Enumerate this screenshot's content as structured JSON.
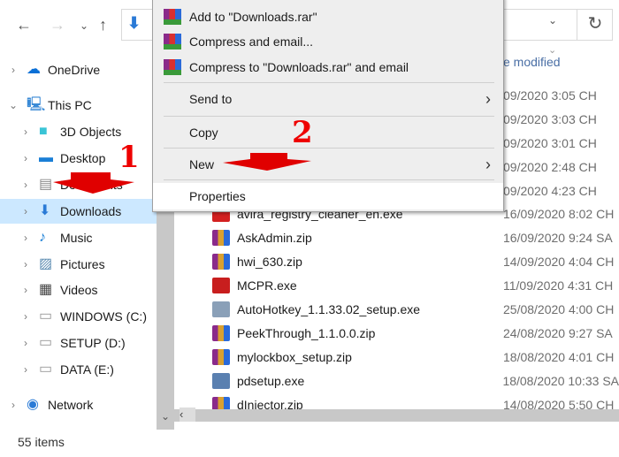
{
  "toolbar": {
    "back_icon": "arrow-left",
    "forward_icon": "arrow-right",
    "recent_icon": "chevron-down",
    "up_icon": "arrow-up",
    "refresh_icon": "refresh"
  },
  "header": {
    "date_modified_partial": "e modified"
  },
  "nav": {
    "items": [
      {
        "label": "OneDrive",
        "icon": "cloud",
        "color": "#0a6fd6"
      },
      {
        "label": "This PC",
        "icon": "computer",
        "color": "#3a8ad6"
      },
      {
        "label": "3D Objects",
        "icon": "cube",
        "color": "#3ac4d6"
      },
      {
        "label": "Desktop",
        "icon": "monitor",
        "color": "#1a7fd6"
      },
      {
        "label": "Documents",
        "icon": "document",
        "color": "#888"
      },
      {
        "label": "Downloads",
        "icon": "download-arrow",
        "color": "#2a7ad6"
      },
      {
        "label": "Music",
        "icon": "music-note",
        "color": "#1a7fd6"
      },
      {
        "label": "Pictures",
        "icon": "picture",
        "color": "#5a8ab0"
      },
      {
        "label": "Videos",
        "icon": "film",
        "color": "#444"
      },
      {
        "label": "WINDOWS (C:)",
        "icon": "drive",
        "color": "#999"
      },
      {
        "label": "SETUP (D:)",
        "icon": "drive",
        "color": "#999"
      },
      {
        "label": "DATA (E:)",
        "icon": "drive",
        "color": "#999"
      },
      {
        "label": "Network",
        "icon": "network",
        "color": "#2a7ad6"
      }
    ]
  },
  "context_menu": {
    "items": [
      {
        "label": "Add to \"Downloads.rar\"",
        "icon": "winrar"
      },
      {
        "label": "Compress and email...",
        "icon": "winrar"
      },
      {
        "label": "Compress to \"Downloads.rar\" and email",
        "icon": "winrar"
      },
      {
        "label": "Send to",
        "submenu": true
      },
      {
        "label": "Copy"
      },
      {
        "label": "New",
        "submenu": true
      },
      {
        "label": "Properties"
      }
    ]
  },
  "partial_dates": [
    "09/2020 3:05 CH",
    "09/2020 3:03 CH",
    "09/2020 3:01 CH",
    "09/2020 2:48 CH",
    "09/2020 4:23 CH"
  ],
  "files": [
    {
      "name": "avira_registry_cleaner_en.exe",
      "date": "16/09/2020 8:02 CH",
      "icon": "avira",
      "color": "#d32020"
    },
    {
      "name": "AskAdmin.zip",
      "date": "16/09/2020 9:24 SA",
      "icon": "winrar",
      "color": "#8a2a8a"
    },
    {
      "name": "hwi_630.zip",
      "date": "14/09/2020 4:04 CH",
      "icon": "winrar",
      "color": "#8a2a8a"
    },
    {
      "name": "MCPR.exe",
      "date": "11/09/2020 4:31 CH",
      "icon": "mcafee",
      "color": "#c81e1e"
    },
    {
      "name": "AutoHotkey_1.1.33.02_setup.exe",
      "date": "25/08/2020 4:00 CH",
      "icon": "installer",
      "color": "#8aa0b8"
    },
    {
      "name": "PeekThrough_1.1.0.0.zip",
      "date": "24/08/2020 9:27 SA",
      "icon": "winrar",
      "color": "#8a2a8a"
    },
    {
      "name": "mylockbox_setup.zip",
      "date": "18/08/2020 4:01 CH",
      "icon": "winrar",
      "color": "#8a2a8a"
    },
    {
      "name": "pdsetup.exe",
      "date": "18/08/2020 10:33 SA",
      "icon": "installer",
      "color": "#5a80b0"
    },
    {
      "name": "dInjector.zip",
      "date": "14/08/2020 5:50 CH",
      "icon": "winrar",
      "color": "#8a2a8a"
    }
  ],
  "status": {
    "items_count": "55 items"
  },
  "annotations": {
    "one": "1",
    "two": "2",
    "color": "#e00000"
  }
}
